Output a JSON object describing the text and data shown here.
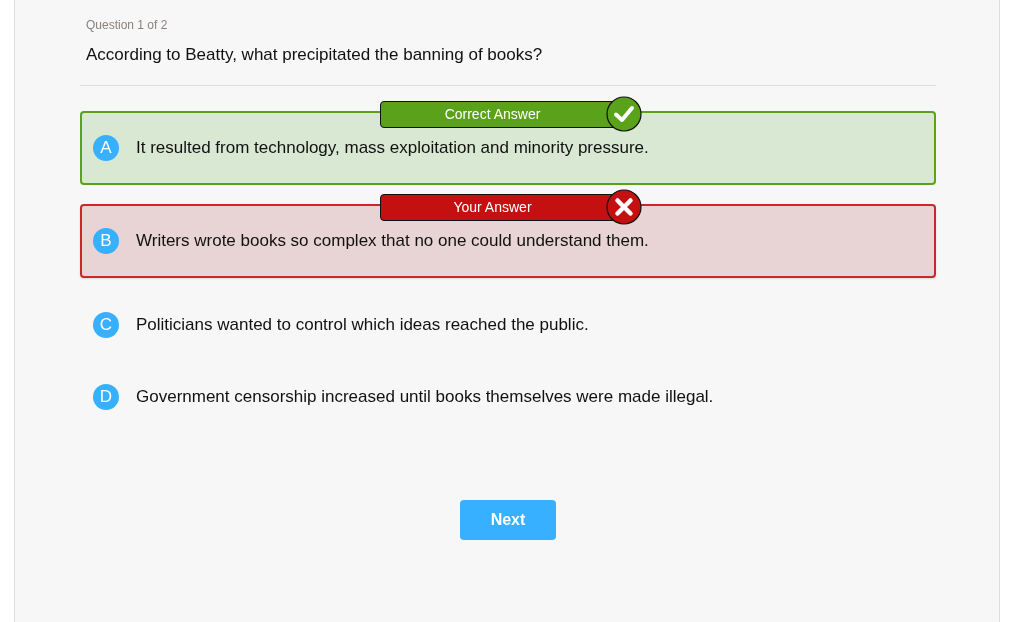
{
  "progress": "Question 1 of 2",
  "question": "According to Beatty, what precipitated the banning of books?",
  "options": [
    {
      "letter": "A",
      "text": "It resulted from technology, mass exploitation and minority pressure.",
      "correct": true,
      "selected": false,
      "badge": "Correct Answer"
    },
    {
      "letter": "B",
      "text": "Writers wrote books so complex that no one could understand them.",
      "correct": false,
      "selected": true,
      "badge": "Your Answer"
    },
    {
      "letter": "C",
      "text": "Politicians wanted to control which ideas reached the public.",
      "correct": false,
      "selected": false
    },
    {
      "letter": "D",
      "text": "Government censorship increased until books themselves were made illegal.",
      "correct": false,
      "selected": false
    }
  ],
  "next_button": "Next"
}
